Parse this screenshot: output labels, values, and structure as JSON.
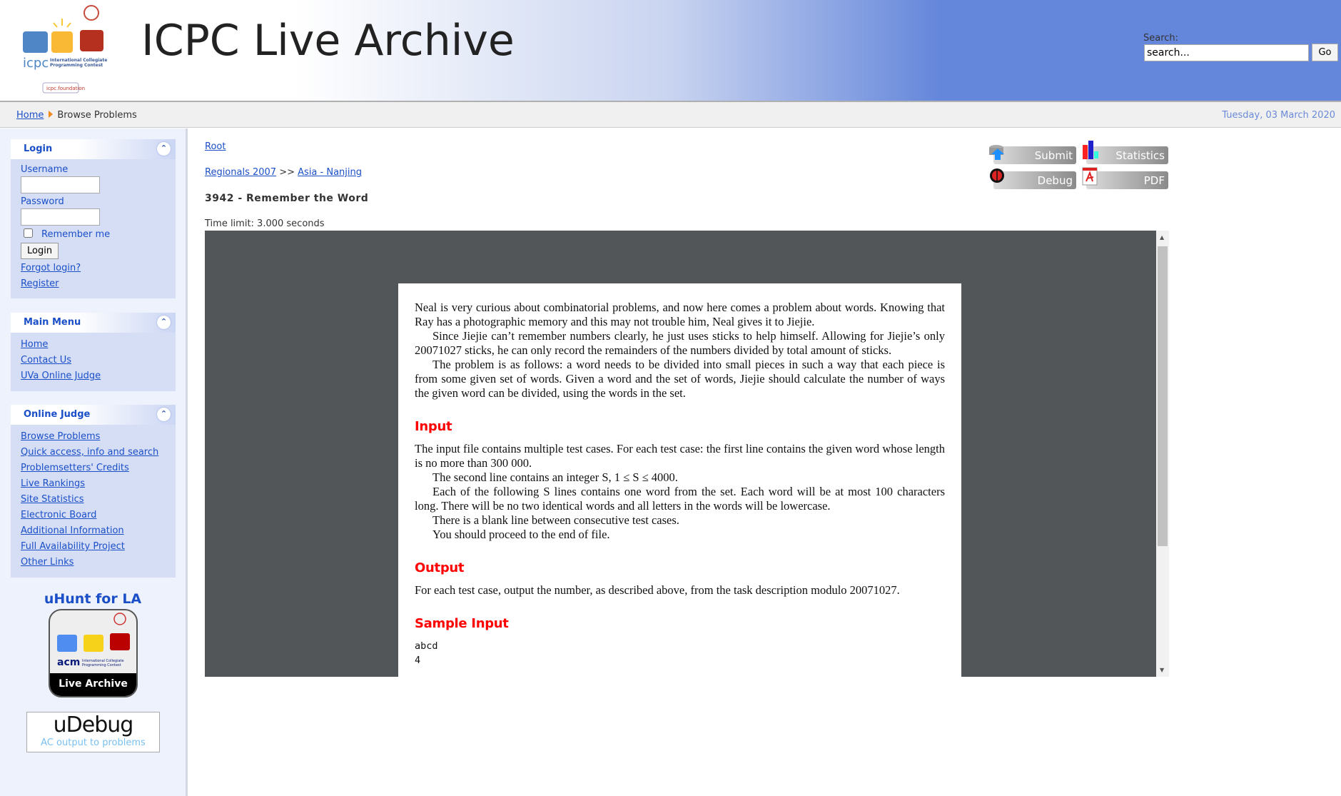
{
  "header": {
    "site_title": "ICPC Live Archive",
    "logo_text": "icpc International Collegiate Programming Contest icpc.foundation",
    "search": {
      "label": "Search:",
      "value": "search...",
      "go_label": "Go"
    }
  },
  "breadcrumb": {
    "home": "Home",
    "current": "Browse Problems",
    "date": "Tuesday, 03 March 2020"
  },
  "sidebar": {
    "login": {
      "title": "Login",
      "username_label": "Username",
      "password_label": "Password",
      "remember_label": "Remember me",
      "login_button": "Login",
      "forgot": "Forgot login?",
      "register": "Register"
    },
    "main_menu": {
      "title": "Main Menu",
      "items": [
        "Home",
        "Contact Us",
        "UVa Online Judge"
      ]
    },
    "online_judge": {
      "title": "Online Judge",
      "items": [
        "Browse Problems",
        "Quick access, info and search",
        "Problemsetters' Credits",
        "Live Rankings",
        "Site Statistics",
        "Electronic Board",
        "Additional Information",
        "Full Availability Project",
        "Other Links"
      ]
    },
    "uhunt": {
      "title": "uHunt for LA",
      "badge_label": "Live Archive"
    },
    "udebug": {
      "logo": "uDebug",
      "subtitle": "AC output to problems"
    }
  },
  "problem": {
    "root": "Root",
    "category": "Regionals 2007",
    "separator": ">>",
    "region": "Asia - Nanjing",
    "title": "3942 - Remember the Word",
    "time_limit": "Time limit: 3.000 seconds",
    "actions": {
      "submit": "Submit",
      "statistics": "Statistics",
      "debug": "Debug",
      "pdf": "PDF"
    },
    "statement": {
      "intro": [
        "Neal is very curious about combinatorial problems, and now here comes a problem about words. Knowing that Ray has a photographic memory and this may not trouble him, Neal gives it to Jiejie.",
        "Since Jiejie can’t remember numbers clearly, he just uses sticks to help himself. Allowing for Jiejie’s only 20071027 sticks, he can only record the remainders of the numbers divided by total amount of sticks.",
        "The problem is as follows: a word needs to be divided into small pieces in such a way that each piece is from some given set of words. Given a word and the set of words, Jiejie should calculate the number of ways the given word can be divided, using the words in the set."
      ],
      "input_heading": "Input",
      "input": [
        "The input file contains multiple test cases. For each test case: the first line contains the given word whose length is no more than 300 000.",
        "The second line contains an integer S, 1 ≤ S ≤ 4000.",
        "Each of the following S lines contains one word from the set. Each word will be at most 100 characters long. There will be no two identical words and all letters in the words will be lowercase.",
        "There is a blank line between consecutive test cases.",
        "You should proceed to the end of file."
      ],
      "output_heading": "Output",
      "output": "For each test case, output the number, as described above, from the task description modulo 20071027.",
      "sample_input_heading": "Sample Input",
      "sample_input": [
        "abcd",
        "4"
      ]
    }
  }
}
